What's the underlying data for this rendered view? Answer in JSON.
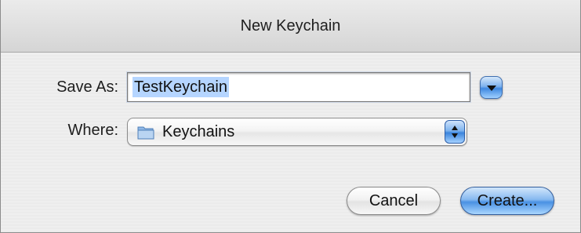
{
  "window": {
    "title": "New Keychain"
  },
  "form": {
    "save_as_label": "Save As:",
    "save_as_value": "TestKeychain",
    "where_label": "Where:",
    "where_value": "Keychains"
  },
  "buttons": {
    "cancel": "Cancel",
    "create": "Create..."
  },
  "icons": {
    "expand": "triangle-down-icon",
    "folder": "folder-icon",
    "stepper": "up-down-arrows-icon"
  },
  "colors": {
    "accent": "#4a91e3",
    "selection": "#b5d5ff"
  }
}
